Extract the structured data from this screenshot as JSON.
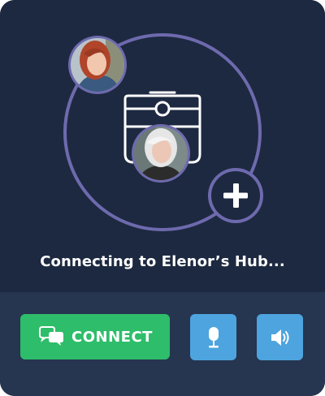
{
  "status": {
    "text": "Connecting to Elenor’s Hub..."
  },
  "actions": {
    "connect_label": "CONNECT"
  },
  "icons": {
    "connect": "chat-bubbles-icon",
    "mic": "microphone-icon",
    "speaker": "speaker-icon",
    "add": "plus-icon",
    "hub": "hub-device-icon"
  },
  "colors": {
    "background": "#1d2940",
    "footer": "#263550",
    "ring": "#6e6aae",
    "connect": "#2ebd6a",
    "control": "#4ea4de"
  }
}
